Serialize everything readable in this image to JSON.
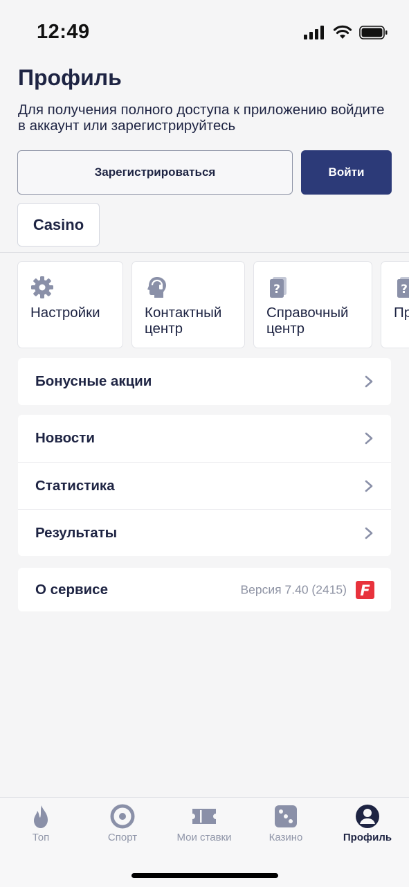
{
  "status": {
    "time": "12:49"
  },
  "header": {
    "title": "Профиль",
    "subtitle": "Для получения полного доступа к приложению войдите в аккаунт или зарегистрируйтесь"
  },
  "auth": {
    "register_label": "Зарегистрироваться",
    "login_label": "Войти",
    "casino_label": "Casino"
  },
  "tiles": [
    {
      "label": "Настройки",
      "icon": "gear-icon"
    },
    {
      "label": "Контактный\nцентр",
      "icon": "support-agent-icon"
    },
    {
      "label": "Справочный\nцентр",
      "icon": "help-book-icon"
    },
    {
      "label": "Пр",
      "icon": "help-book-icon"
    }
  ],
  "menu": {
    "bonus": "Бонусные акции",
    "news": "Новости",
    "stats": "Статистика",
    "results": "Результаты"
  },
  "about": {
    "label": "О сервисе",
    "version": "Версия 7.40 (2415)",
    "logo_letter": "F"
  },
  "tabbar": [
    {
      "label": "Топ",
      "icon": "flame-icon"
    },
    {
      "label": "Спорт",
      "icon": "target-icon"
    },
    {
      "label": "Мои ставки",
      "icon": "ticket-icon"
    },
    {
      "label": "Казино",
      "icon": "dice-icon"
    },
    {
      "label": "Профиль",
      "icon": "user-icon",
      "active": true
    }
  ],
  "colors": {
    "primary": "#2c3a78",
    "text": "#1e2443",
    "muted": "#8f95a8",
    "brand_red": "#e8323c",
    "background": "#f5f5f6"
  }
}
